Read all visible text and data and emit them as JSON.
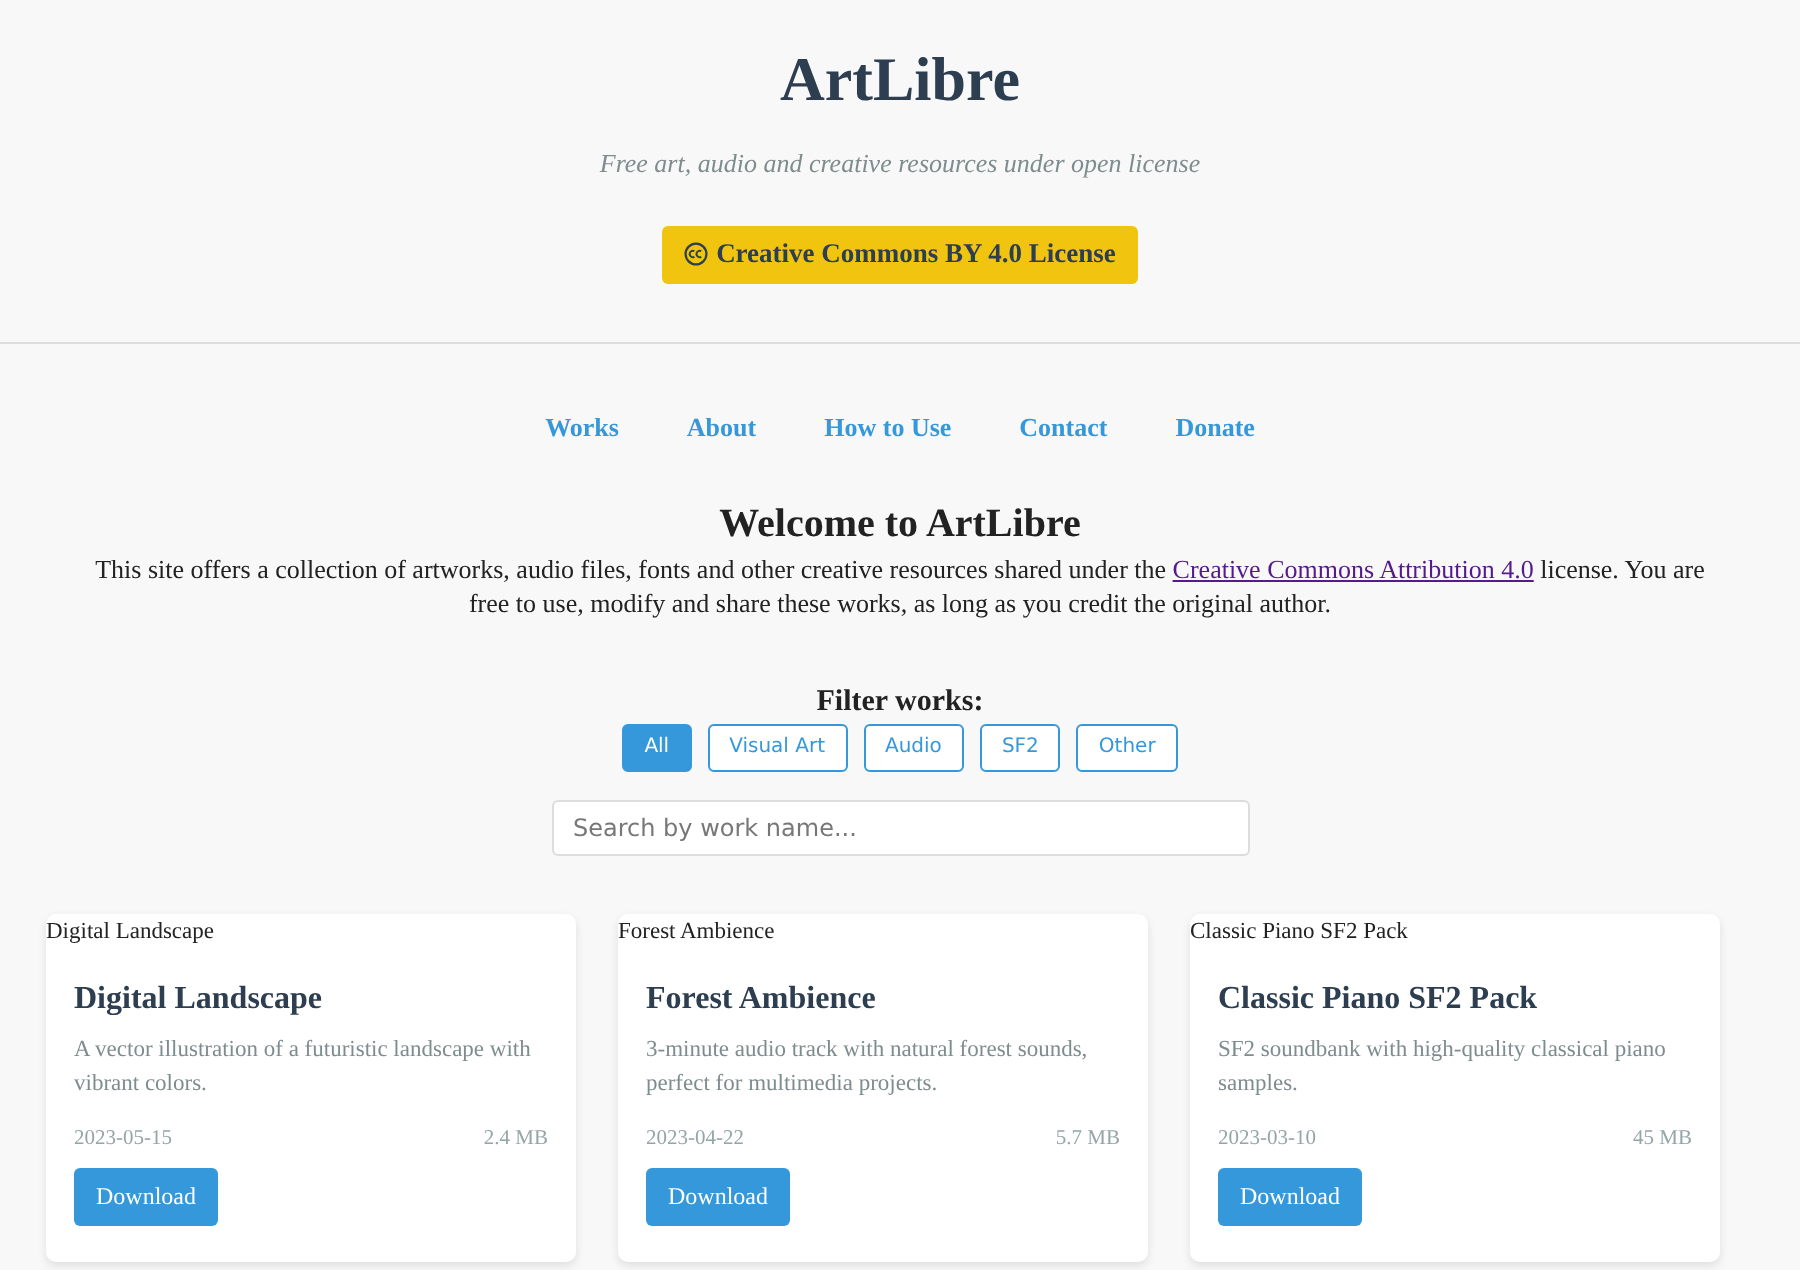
{
  "header": {
    "title": "ArtLibre",
    "subtitle": "Free art, audio and creative resources under open license",
    "license_button": "Creative Commons BY 4.0 License"
  },
  "nav": [
    "Works",
    "About",
    "How to Use",
    "Contact",
    "Donate"
  ],
  "intro": {
    "heading": "Welcome to ArtLibre",
    "text_before": "This site offers a collection of artworks, audio files, fonts and other creative resources shared under the",
    "link": "Creative Commons Attribution 4.0",
    "text_after": "license. You are free to use, modify and share these works, as long as you credit the original author."
  },
  "filter": {
    "label": "Filter works:",
    "options": [
      {
        "label": "All",
        "selected": true
      },
      {
        "label": "Visual Art",
        "selected": false
      },
      {
        "label": "Audio",
        "selected": false
      },
      {
        "label": "SF2",
        "selected": false
      },
      {
        "label": "Other",
        "selected": false
      }
    ]
  },
  "search": {
    "placeholder": "Search by work name..."
  },
  "works": [
    {
      "image_alt": "Digital Landscape",
      "title": "Digital Landscape",
      "description": "A vector illustration of a futuristic landscape with vibrant colors.",
      "date": "2023-05-15",
      "size": "2.4 MB",
      "button": "Download"
    },
    {
      "image_alt": "Forest Ambience",
      "title": "Forest Ambience",
      "description": "3-minute audio track with natural forest sounds, perfect for multimedia projects.",
      "date": "2023-04-22",
      "size": "5.7 MB",
      "button": "Download"
    },
    {
      "image_alt": "Classic Piano SF2 Pack",
      "title": "Classic Piano SF2 Pack",
      "description": "SF2 soundbank with high-quality classical piano samples.",
      "date": "2023-03-10",
      "size": "45 MB",
      "button": "Download"
    }
  ]
}
